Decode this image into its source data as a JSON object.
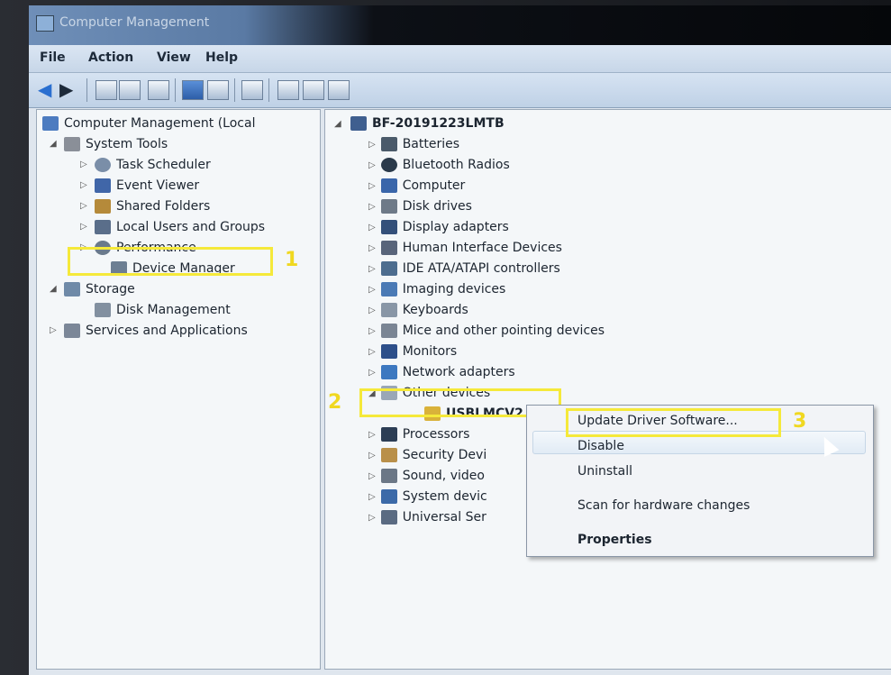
{
  "window": {
    "title": "Computer Management"
  },
  "menu": [
    "File",
    "Action",
    "View",
    "Help"
  ],
  "left_tree": {
    "root": "Computer Management (Local",
    "system_tools": "System Tools",
    "items": [
      "Task Scheduler",
      "Event Viewer",
      "Shared Folders",
      "Local Users and Groups",
      "Performance",
      "Device Manager"
    ],
    "storage": "Storage",
    "disk_management": "Disk Management",
    "services": "Services and Applications"
  },
  "device_tree": {
    "computer": "BF-20191223LMTB",
    "categories": [
      "Batteries",
      "Bluetooth Radios",
      "Computer",
      "Disk drives",
      "Display adapters",
      "Human Interface Devices",
      "IDE ATA/ATAPI controllers",
      "Imaging devices",
      "Keyboards",
      "Mice and other pointing devices",
      "Monitors",
      "Network adapters",
      "Other devices"
    ],
    "unknown_device": "USBLMCV2",
    "after": [
      "Processors",
      "Security Devi",
      "Sound, video",
      "System devic",
      "Universal Ser"
    ]
  },
  "context_menu": {
    "items": [
      "Update Driver Software...",
      "Disable",
      "Uninstall",
      "Scan for hardware changes",
      "Properties"
    ]
  },
  "annotations": {
    "step1": "1",
    "step2": "2",
    "step3": "3"
  },
  "colors": {
    "highlight": "#f5e93a",
    "step_number": "#f0d820"
  }
}
